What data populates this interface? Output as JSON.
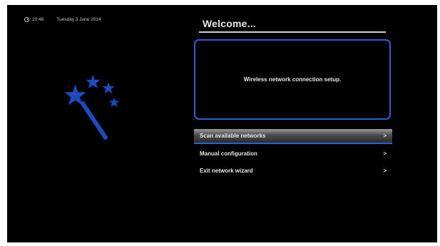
{
  "status": {
    "time": "20:48",
    "date": "Tuesday 3 June 2014"
  },
  "wizard": {
    "icon": "magic-wand-stars-icon",
    "color": "#1a4bc0"
  },
  "title": "Welcome...",
  "info": {
    "message": "Wireless network connection setup."
  },
  "menu": {
    "items": [
      {
        "label": "Scan available networks",
        "arrow": ">",
        "selected": true
      },
      {
        "label": "Manual configuration",
        "arrow": ">",
        "selected": false
      },
      {
        "label": "Exit network wizard",
        "arrow": ">",
        "selected": false
      }
    ]
  },
  "colors": {
    "accent": "#2a5fd9",
    "background": "#000000"
  }
}
